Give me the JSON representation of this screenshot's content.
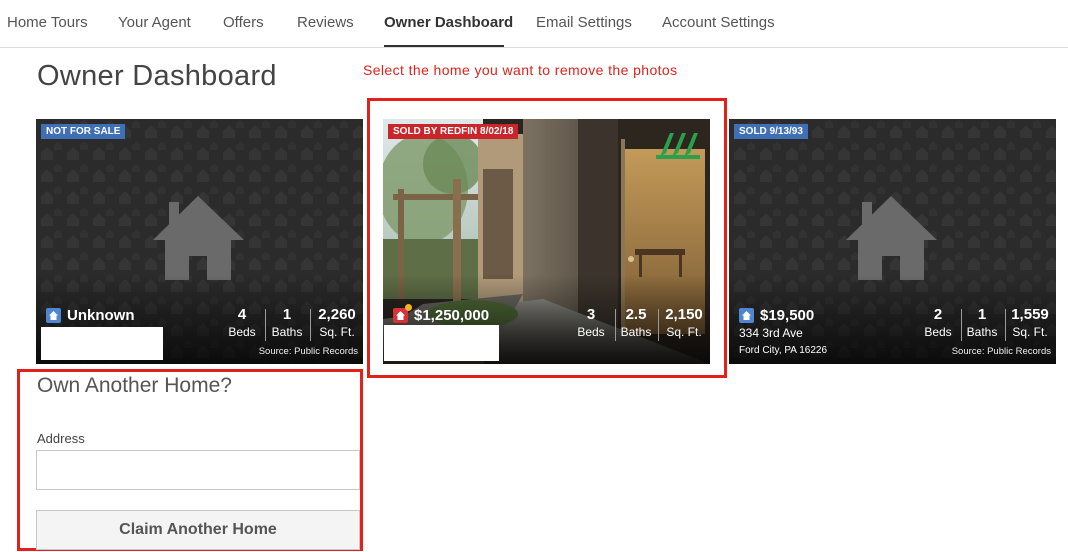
{
  "nav": {
    "items": [
      {
        "label": "Home Tours"
      },
      {
        "label": "Your Agent"
      },
      {
        "label": "Offers"
      },
      {
        "label": "Reviews"
      },
      {
        "label": "Owner Dashboard",
        "active": true
      },
      {
        "label": "Email Settings"
      },
      {
        "label": "Account Settings"
      }
    ]
  },
  "page_title": "Owner Dashboard",
  "instruction": "Select the home you want to remove the photos",
  "cards": [
    {
      "badge": "NOT FOR SALE",
      "badge_color": "#3f6fb5",
      "price": "Unknown",
      "beds": "4",
      "beds_label": "Beds",
      "baths": "1",
      "baths_label": "Baths",
      "sqft": "2,260",
      "sqft_label": "Sq. Ft.",
      "source": "Source: Public Records",
      "image": "placeholder-house-icon"
    },
    {
      "badge": "SOLD BY REDFIN 8/02/18",
      "badge_color": "#c9252b",
      "price": "$1,250,000",
      "beds": "3",
      "beds_label": "Beds",
      "baths": "2.5",
      "baths_label": "Baths",
      "sqft": "2,150",
      "sqft_label": "Sq. Ft.",
      "image": "home-entrance-photo",
      "logo": "redfin-logo-icon"
    },
    {
      "badge": "SOLD 9/13/93",
      "badge_color": "#3f6fb5",
      "price": "$19,500",
      "address_line1": "334 3rd Ave",
      "address_line2": "Ford City, PA 16226",
      "beds": "2",
      "beds_label": "Beds",
      "baths": "1",
      "baths_label": "Baths",
      "sqft": "1,559",
      "sqft_label": "Sq. Ft.",
      "source": "Source: Public Records",
      "image": "placeholder-house-icon"
    }
  ],
  "claim": {
    "title": "Own Another Home?",
    "address_label": "Address",
    "address_value": "",
    "address_placeholder": "",
    "button_label": "Claim Another Home"
  },
  "colors": {
    "highlight_red": "#e0221b",
    "badge_blue": "#3f6fb5",
    "badge_red": "#c9252b"
  }
}
